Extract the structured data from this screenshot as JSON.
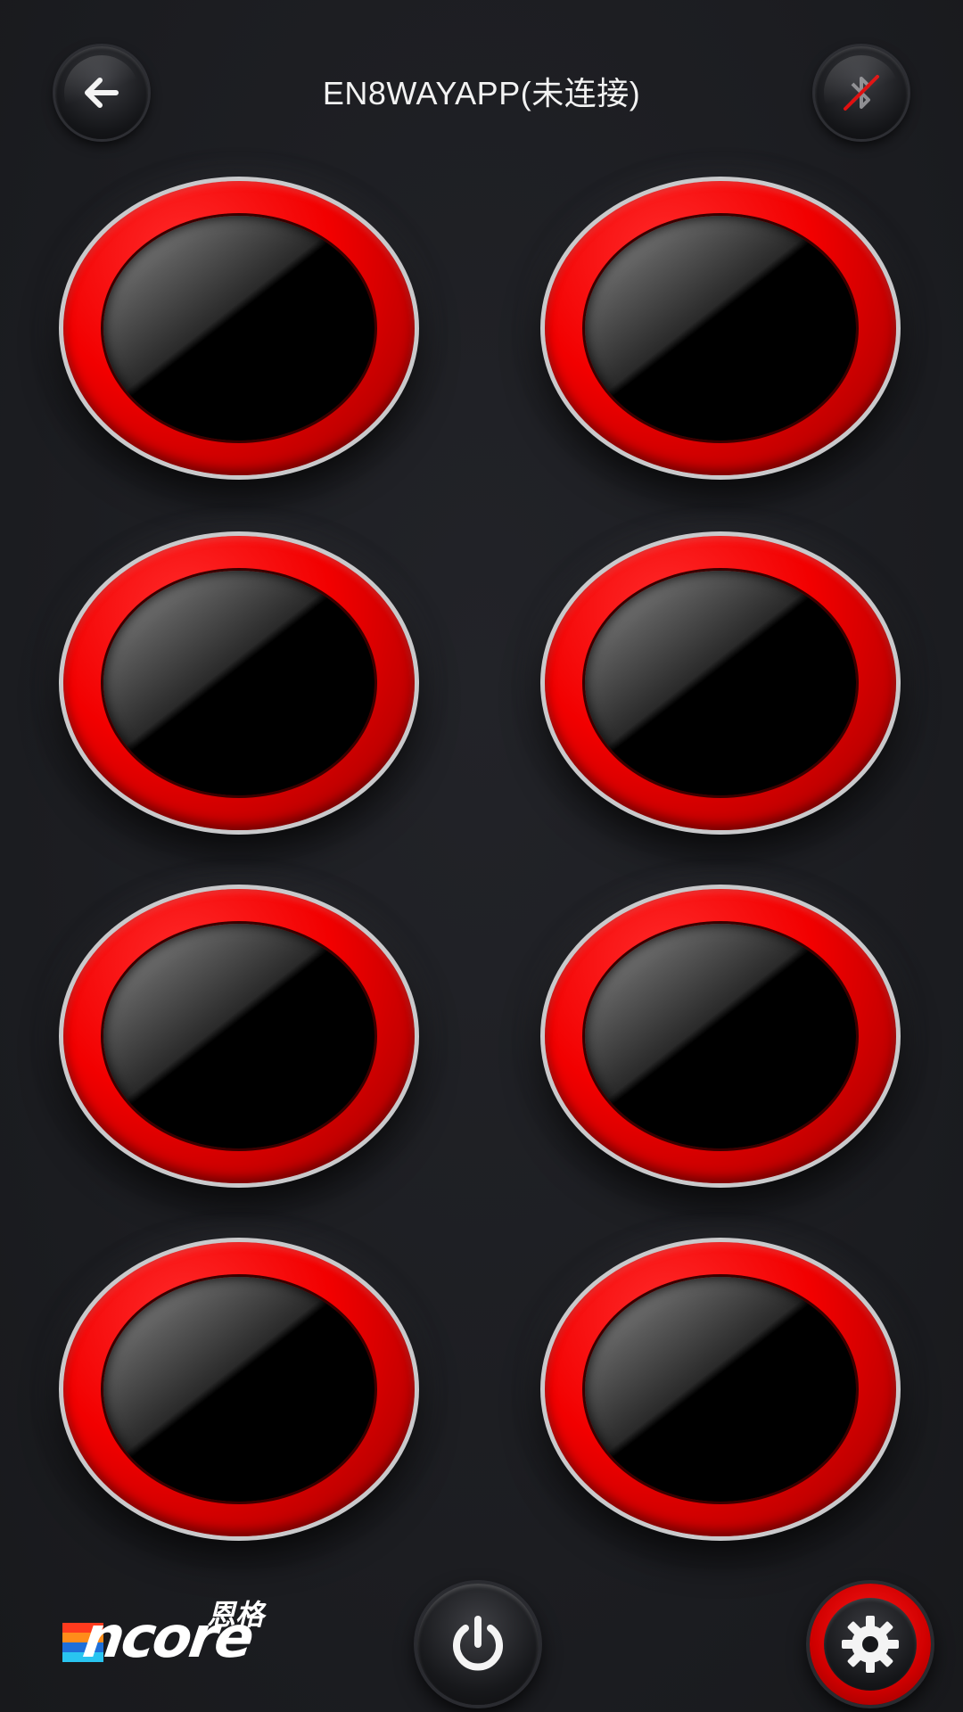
{
  "header": {
    "title": "EN8WAYAPP(未连接)",
    "back_icon": "arrow-left-icon",
    "bluetooth_icon": "bluetooth-off-icon"
  },
  "switches": [
    {
      "state": "off"
    },
    {
      "state": "off"
    },
    {
      "state": "off"
    },
    {
      "state": "off"
    },
    {
      "state": "off"
    },
    {
      "state": "off"
    },
    {
      "state": "off"
    },
    {
      "state": "off"
    }
  ],
  "footer": {
    "logo_text": "ncore",
    "logo_cn": "恩格",
    "power_icon": "power-icon",
    "settings_icon": "gear-icon"
  },
  "colors": {
    "background": "#1c1d21",
    "switch_ring": "#f20000",
    "logo_stripe_1": "#ff3b1e",
    "logo_stripe_2": "#ff8c1a",
    "logo_stripe_3": "#1e6fd9",
    "logo_stripe_4": "#29c4f0"
  }
}
